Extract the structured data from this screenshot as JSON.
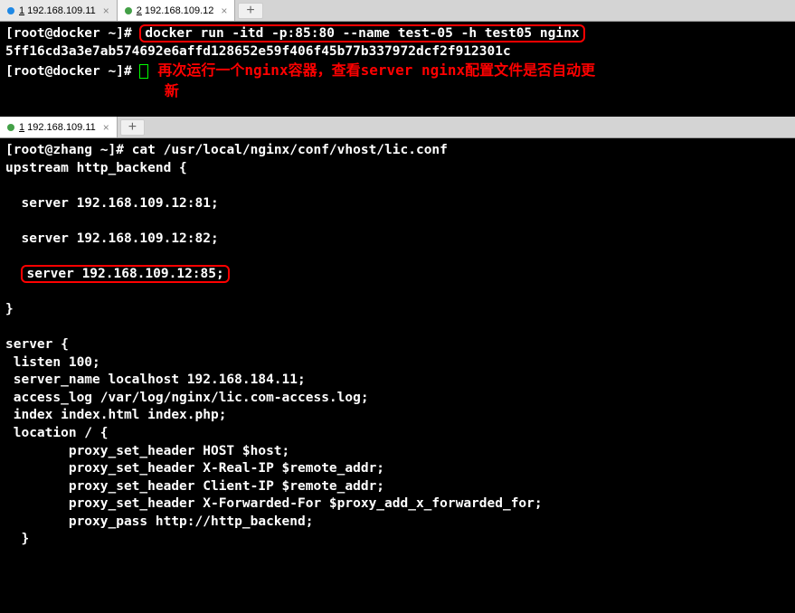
{
  "top_tabs": {
    "tab1": {
      "num": "1",
      "ip": "192.168.109.11"
    },
    "tab2": {
      "num": "2",
      "ip": "192.168.109.12"
    }
  },
  "bottom_tabs": {
    "tab1": {
      "num": "1",
      "ip": "192.168.109.11"
    }
  },
  "terminal_top": {
    "prompt1": "[root@docker ~]# ",
    "command1": "docker run -itd -p:85:80 --name test-05 -h test05 nginx",
    "output1": "5ff16cd3a3e7ab574692e6affd128652e59f406f45b77b337972dcf2f912301c",
    "prompt2": "[root@docker ~]# ",
    "annotation_line1": "再次运行一个nginx容器，查看server nginx配置文件是否自动更",
    "annotation_line2": "新"
  },
  "terminal_bottom": {
    "prompt": "[root@zhang ~]# ",
    "command": "cat /usr/local/nginx/conf/vhost/lic.conf",
    "line1": "upstream http_backend {",
    "line2": "",
    "line3": "  server 192.168.109.12:81;",
    "line4": "",
    "line5": "  server 192.168.109.12:82;",
    "line6": "",
    "line7_highlight": "server 192.168.109.12:85;",
    "line8": "",
    "line9": "}",
    "line10": "",
    "line11": "server {",
    "line12": " listen 100;",
    "line13": " server_name localhost 192.168.184.11;",
    "line14": " access_log /var/log/nginx/lic.com-access.log;",
    "line15": " index index.html index.php;",
    "line16": " location / {",
    "line17": "        proxy_set_header HOST $host;",
    "line18": "        proxy_set_header X-Real-IP $remote_addr;",
    "line19": "        proxy_set_header Client-IP $remote_addr;",
    "line20": "        proxy_set_header X-Forwarded-For $proxy_add_x_forwarded_for;",
    "line21": "        proxy_pass http://http_backend;",
    "line22": "  }"
  }
}
